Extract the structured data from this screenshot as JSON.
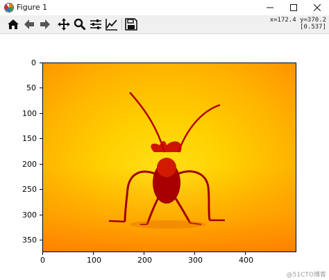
{
  "window": {
    "title": "Figure 1",
    "app_icon": "matplotlib-icon",
    "controls": [
      "minimize-icon",
      "maximize-icon",
      "close-icon"
    ]
  },
  "toolbar": {
    "tools": [
      {
        "name": "home-button",
        "icon": "home-icon"
      },
      {
        "name": "back-button",
        "icon": "arrow-left-icon"
      },
      {
        "name": "forward-button",
        "icon": "arrow-right-icon"
      },
      {
        "name": "pan-button",
        "icon": "move-icon"
      },
      {
        "name": "zoom-button",
        "icon": "zoom-icon"
      },
      {
        "name": "subplots-button",
        "icon": "sliders-icon"
      },
      {
        "name": "edit-axes-button",
        "icon": "chart-line-icon"
      },
      {
        "name": "save-button",
        "icon": "floppy-icon"
      }
    ],
    "coords_line1": "x=172.4 y=370.2",
    "coords_line2": "[0.537]"
  },
  "plot": {
    "image_description": "insect",
    "yticks": [
      "0",
      "50",
      "100",
      "150",
      "200",
      "250",
      "300",
      "350"
    ],
    "xticks": [
      "0",
      "100",
      "200",
      "300",
      "400"
    ],
    "colormap_colors": [
      "#ff9200",
      "#ffd000",
      "#ffe11a",
      "#b30000"
    ]
  },
  "watermark": "@51CTO博客"
}
